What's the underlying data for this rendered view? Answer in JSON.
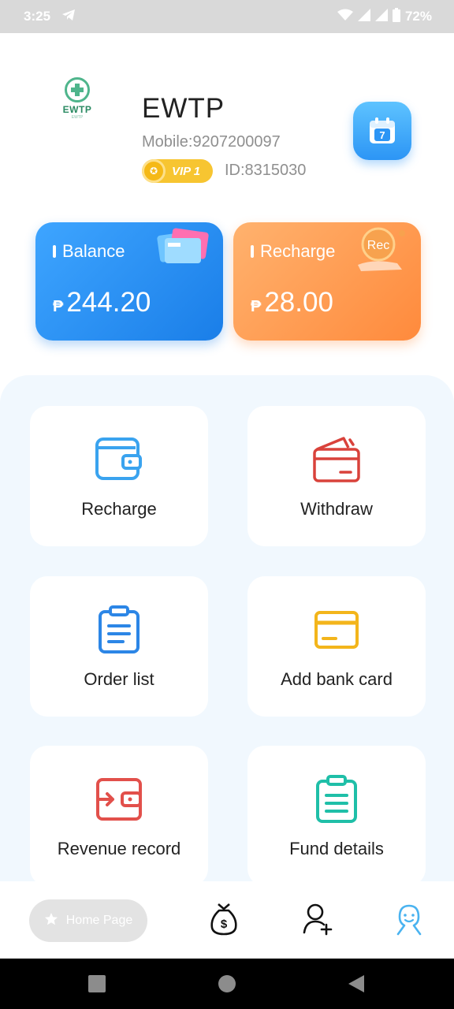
{
  "status_bar": {
    "time": "3:25",
    "battery": "72%"
  },
  "header": {
    "logo_text": "EWTP",
    "logo_subtext": "EWTP",
    "username": "EWTP",
    "mobile": "Mobile:9207200097",
    "vip_label": "VIP 1",
    "user_id": "ID:8315030",
    "calendar_day": "7"
  },
  "cards": {
    "balance": {
      "label": "Balance",
      "currency": "₱",
      "amount": "244.20"
    },
    "recharge": {
      "label": "Recharge",
      "currency": "₱",
      "amount": "28.00",
      "badge": "Rec"
    }
  },
  "menu": {
    "recharge": "Recharge",
    "withdraw": "Withdraw",
    "order_list": "Order list",
    "add_bank_card": "Add bank card",
    "revenue_record": "Revenue record",
    "fund_details": "Fund details"
  },
  "bottom_nav": {
    "home_label": "Home Page"
  },
  "colors": {
    "primary_blue": "#2c95f5",
    "orange": "#ff8a3c",
    "panel_bg": "#f1f8fe",
    "icon_red": "#d9423b",
    "icon_yellow": "#f3b51b",
    "icon_teal": "#1fbfa8"
  }
}
